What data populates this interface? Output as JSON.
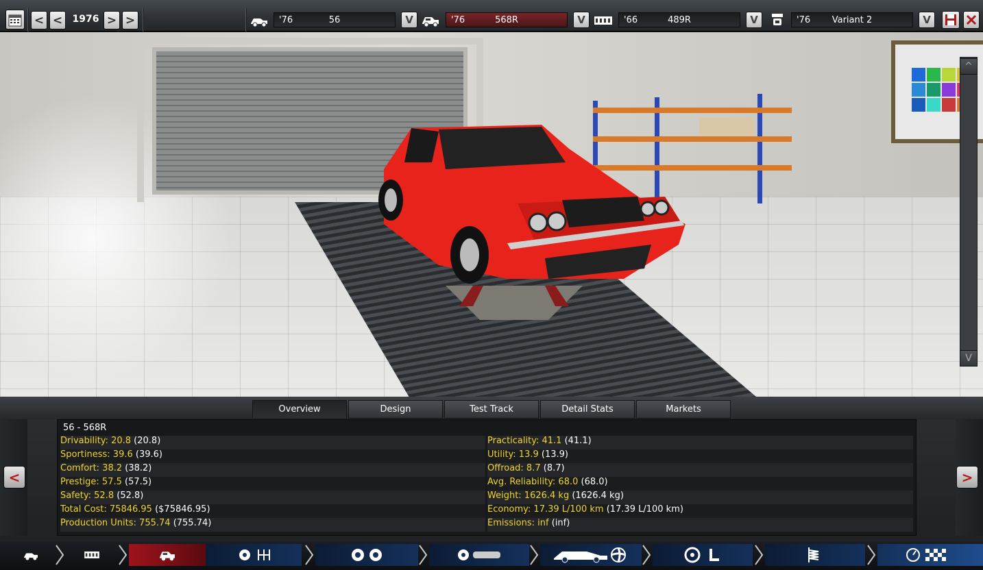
{
  "topbar": {
    "year": "1976",
    "prev_far": "<",
    "prev": "<",
    "next": ">",
    "next_far": ">",
    "model": {
      "year": "'76",
      "name": "56"
    },
    "trim": {
      "year": "'76",
      "name": "568R"
    },
    "engine": {
      "year": "'66",
      "name": "489R"
    },
    "variant": {
      "year": "'76",
      "name": "Variant 2"
    },
    "dropdown": "V"
  },
  "scene": {
    "scroll_up": "^",
    "scroll_down": "V"
  },
  "tabs": [
    "Overview",
    "Design",
    "Test Track",
    "Detail Stats",
    "Markets"
  ],
  "active_tab": "Overview",
  "stats": {
    "title": "56 - 568R",
    "left": [
      {
        "label": "Drivability: 20.8",
        "paren": "(20.8)"
      },
      {
        "label": "Sportiness: 39.6",
        "paren": "(39.6)"
      },
      {
        "label": "Comfort: 38.2",
        "paren": "(38.2)"
      },
      {
        "label": "Prestige: 57.5",
        "paren": "(57.5)"
      },
      {
        "label": "Safety: 52.8",
        "paren": "(52.8)"
      },
      {
        "label": "Total Cost: 75846.95",
        "paren": "($75846.95)"
      },
      {
        "label": "Production Units: 755.74",
        "paren": "(755.74)"
      }
    ],
    "right": [
      {
        "label": "Practicality: 41.1",
        "paren": "(41.1)"
      },
      {
        "label": "Utility: 13.9",
        "paren": "(13.9)"
      },
      {
        "label": "Offroad: 8.7",
        "paren": "(8.7)"
      },
      {
        "label": "Avg. Reliability: 68.0",
        "paren": "(68.0)"
      },
      {
        "label": "Weight: 1626.4 kg",
        "paren": "(1626.4 kg)"
      },
      {
        "label": "Economy: 17.39 L/100 km",
        "paren": "(17.39 L/100 km)"
      },
      {
        "label": "Emissions: inf",
        "paren": "(inf)"
      }
    ]
  },
  "nav": {
    "prev": "<",
    "next": ">"
  },
  "colors": {
    "stat_key": "#f0d52a",
    "accent_red": "#b81c1c",
    "car_red": "#e8231c",
    "strip_active": "#a0131c"
  }
}
